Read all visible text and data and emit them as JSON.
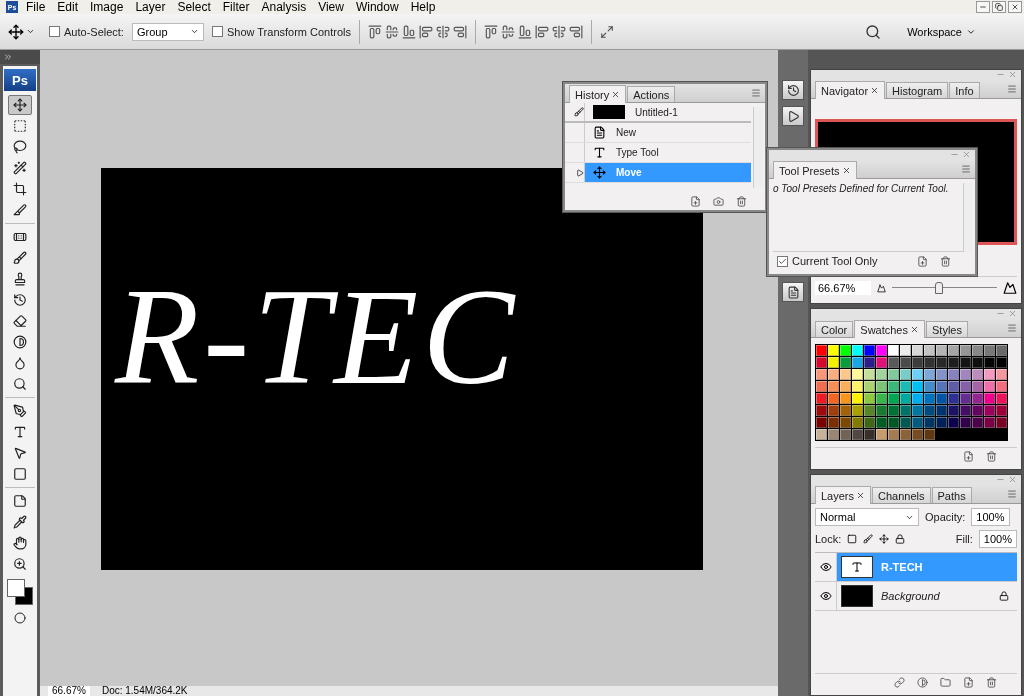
{
  "menu_bar": {
    "app_icon": "Ps",
    "items": [
      "File",
      "Edit",
      "Image",
      "Layer",
      "Select",
      "Filter",
      "Analysis",
      "View",
      "Window",
      "Help"
    ]
  },
  "options_bar": {
    "auto_select": {
      "label": "Auto-Select:",
      "checked": false
    },
    "auto_select_mode": "Group",
    "transform_controls": {
      "label": "Show Transform Controls",
      "checked": false
    },
    "workspace": "Workspace"
  },
  "toolbox": {
    "logo": "Ps",
    "groups": [
      [
        {
          "kind": "move",
          "selected": true
        },
        {
          "kind": "marquee",
          "selected": false
        },
        {
          "kind": "lasso",
          "selected": false
        },
        {
          "kind": "quick-select",
          "selected": false
        },
        {
          "kind": "crop",
          "selected": false
        },
        {
          "kind": "slice",
          "selected": false
        }
      ],
      [
        {
          "kind": "healing",
          "selected": false
        },
        {
          "kind": "brush",
          "selected": false
        },
        {
          "kind": "stamp",
          "selected": false
        },
        {
          "kind": "history-brush",
          "selected": false
        },
        {
          "kind": "eraser",
          "selected": false
        },
        {
          "kind": "gradient",
          "selected": false
        },
        {
          "kind": "blur",
          "selected": false
        },
        {
          "kind": "dodge",
          "selected": false
        }
      ],
      [
        {
          "kind": "pen",
          "selected": false
        },
        {
          "kind": "type",
          "selected": false
        },
        {
          "kind": "path-select",
          "selected": false
        },
        {
          "kind": "shape",
          "selected": false
        }
      ],
      [
        {
          "kind": "notes",
          "selected": false
        },
        {
          "kind": "eyedropper",
          "selected": false
        },
        {
          "kind": "hand",
          "selected": false
        },
        {
          "kind": "zoom",
          "selected": false
        }
      ]
    ]
  },
  "document": {
    "text": "R-TEC"
  },
  "status_bar": {
    "zoom": "66.67%",
    "doc_info": "Doc: 1.54M/364.2K"
  },
  "history_panel": {
    "tabs": [
      {
        "label": "History",
        "selected": true
      },
      {
        "label": "Actions",
        "selected": false
      }
    ],
    "snapshot": "Untitled-1",
    "items": [
      {
        "kind": "new",
        "label": "New",
        "selected": false
      },
      {
        "kind": "type",
        "label": "Type Tool",
        "selected": false
      },
      {
        "kind": "move",
        "label": "Move",
        "selected": true
      }
    ]
  },
  "tool_presets_panel": {
    "tabs": [
      {
        "label": "Tool Presets",
        "selected": true
      }
    ],
    "message": "o Tool Presets Defined for Current Tool.",
    "current_tool_only": {
      "label": "Current Tool Only",
      "checked": true
    }
  },
  "navigator_panel": {
    "tabs": [
      {
        "label": "Navigator",
        "selected": true
      },
      {
        "label": "Histogram",
        "selected": false
      },
      {
        "label": "Info",
        "selected": false
      }
    ],
    "zoom": "66.67%",
    "level": 0.45
  },
  "swatches_panel": {
    "tabs": [
      {
        "label": "Color",
        "selected": false
      },
      {
        "label": "Swatches",
        "selected": true
      },
      {
        "label": "Styles",
        "selected": false
      }
    ],
    "swatches": [
      {
        "color": "#ff0000"
      },
      {
        "color": "#ffff00"
      },
      {
        "color": "#00ff00"
      },
      {
        "color": "#00ffff"
      },
      {
        "color": "#0000ff"
      },
      {
        "color": "#ff00ff"
      },
      {
        "color": "#ffffff"
      },
      {
        "color": "#ebebeb"
      },
      {
        "color": "#d7d7d7"
      },
      {
        "color": "#c3c3c3"
      },
      {
        "color": "#b4b4b4"
      },
      {
        "color": "#a5a5a5"
      },
      {
        "color": "#969696"
      },
      {
        "color": "#878787"
      },
      {
        "color": "#787878"
      },
      {
        "color": "#696969"
      },
      {
        "color": "#d4082a"
      },
      {
        "color": "#f5f000"
      },
      {
        "color": "#0a9b3c"
      },
      {
        "color": "#1aa5e6"
      },
      {
        "color": "#2b1e8c"
      },
      {
        "color": "#e0127a"
      },
      {
        "color": "#5a5a5a"
      },
      {
        "color": "#4b4b4b"
      },
      {
        "color": "#3c3c3c"
      },
      {
        "color": "#323232"
      },
      {
        "color": "#282828"
      },
      {
        "color": "#1e1e1e"
      },
      {
        "color": "#141414"
      },
      {
        "color": "#0f0f0f"
      },
      {
        "color": "#050505"
      },
      {
        "color": "#000000"
      },
      {
        "color": "#f79679"
      },
      {
        "color": "#f9ad81"
      },
      {
        "color": "#fdc68a"
      },
      {
        "color": "#fff79a"
      },
      {
        "color": "#c4df9b"
      },
      {
        "color": "#a3d39c"
      },
      {
        "color": "#82ca9c"
      },
      {
        "color": "#7accc8"
      },
      {
        "color": "#6dcff6"
      },
      {
        "color": "#7da7d9"
      },
      {
        "color": "#8393ca"
      },
      {
        "color": "#8781bd"
      },
      {
        "color": "#a186be"
      },
      {
        "color": "#bd8cbf"
      },
      {
        "color": "#f49ac1"
      },
      {
        "color": "#f5989d"
      },
      {
        "color": "#f26c4f"
      },
      {
        "color": "#f68e55"
      },
      {
        "color": "#fbaf5c"
      },
      {
        "color": "#fff467"
      },
      {
        "color": "#acd372"
      },
      {
        "color": "#7cc576"
      },
      {
        "color": "#3bb878"
      },
      {
        "color": "#1abbb4"
      },
      {
        "color": "#00bff3"
      },
      {
        "color": "#438ccb"
      },
      {
        "color": "#5574b9"
      },
      {
        "color": "#605ca8"
      },
      {
        "color": "#855fa8"
      },
      {
        "color": "#a763a8"
      },
      {
        "color": "#f06ea9"
      },
      {
        "color": "#f26d7d"
      },
      {
        "color": "#ed1c24"
      },
      {
        "color": "#f26522"
      },
      {
        "color": "#f7941d"
      },
      {
        "color": "#fff200"
      },
      {
        "color": "#8dc73f"
      },
      {
        "color": "#39b54a"
      },
      {
        "color": "#00a651"
      },
      {
        "color": "#00a99d"
      },
      {
        "color": "#00aeef"
      },
      {
        "color": "#0072bc"
      },
      {
        "color": "#0054a6"
      },
      {
        "color": "#2e3192"
      },
      {
        "color": "#662d91"
      },
      {
        "color": "#92278f"
      },
      {
        "color": "#ec008c"
      },
      {
        "color": "#ed145b"
      },
      {
        "color": "#9e0b0f"
      },
      {
        "color": "#a0410d"
      },
      {
        "color": "#a3620a"
      },
      {
        "color": "#aba000"
      },
      {
        "color": "#598527"
      },
      {
        "color": "#197b30"
      },
      {
        "color": "#007236"
      },
      {
        "color": "#00746b"
      },
      {
        "color": "#0076a3"
      },
      {
        "color": "#004b80"
      },
      {
        "color": "#003471"
      },
      {
        "color": "#1b1464"
      },
      {
        "color": "#440e62"
      },
      {
        "color": "#630460"
      },
      {
        "color": "#9e005d"
      },
      {
        "color": "#9e0039"
      },
      {
        "color": "#790000"
      },
      {
        "color": "#7b2e00"
      },
      {
        "color": "#7d4900"
      },
      {
        "color": "#827b00"
      },
      {
        "color": "#406618"
      },
      {
        "color": "#005e20"
      },
      {
        "color": "#005826"
      },
      {
        "color": "#005952"
      },
      {
        "color": "#005b7f"
      },
      {
        "color": "#003663"
      },
      {
        "color": "#002157"
      },
      {
        "color": "#0d004c"
      },
      {
        "color": "#32004b"
      },
      {
        "color": "#4b0049"
      },
      {
        "color": "#7b0046"
      },
      {
        "color": "#7a0026"
      },
      {
        "color": "#c7b299"
      },
      {
        "color": "#998675"
      },
      {
        "color": "#736357"
      },
      {
        "color": "#534741"
      },
      {
        "color": "#37302a"
      },
      {
        "color": "#c69c6d"
      },
      {
        "color": "#a67c52"
      },
      {
        "color": "#8c6239"
      },
      {
        "color": "#754c24"
      },
      {
        "color": "#603913"
      }
    ]
  },
  "layers_panel": {
    "tabs": [
      {
        "label": "Layers",
        "selected": true
      },
      {
        "label": "Channels",
        "selected": false
      },
      {
        "label": "Paths",
        "selected": false
      }
    ],
    "blend_mode": "Normal",
    "opacity_label": "Opacity:",
    "opacity": "100%",
    "lock_label": "Lock:",
    "fill_label": "Fill:",
    "fill": "100%",
    "layers": [
      {
        "kind": "text",
        "name": "R-TECH",
        "selected": true,
        "visible": true,
        "locked": false
      },
      {
        "kind": "image",
        "name": "Background",
        "selected": false,
        "visible": true,
        "locked": true
      }
    ]
  }
}
